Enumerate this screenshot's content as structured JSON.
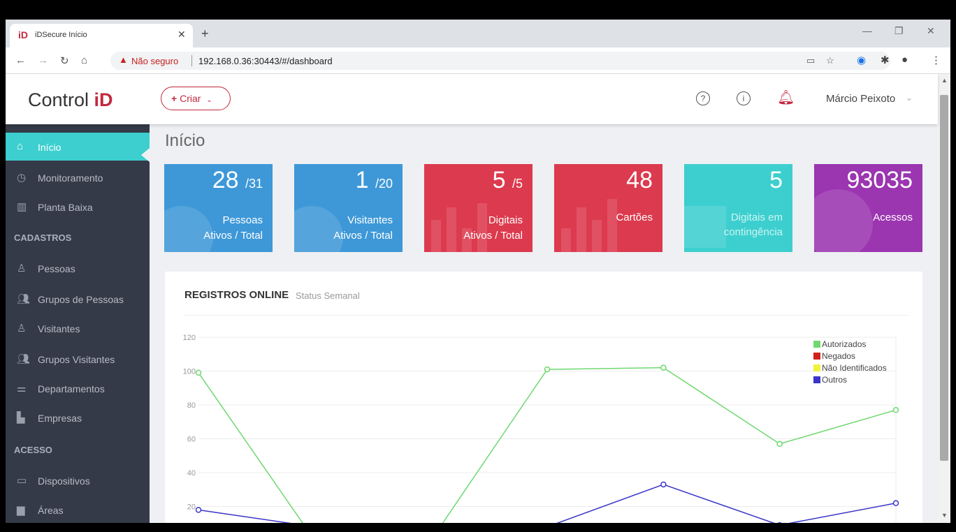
{
  "browser": {
    "tab_title": "iDSecure Início",
    "tab_favicon": "iD",
    "security_label": "Não seguro",
    "url": "192.168.0.36:30443/#/dashboard"
  },
  "header": {
    "logo_text": "Control ",
    "logo_brand": "iD",
    "create_label": "Criar",
    "user_name": "Márcio Peixoto",
    "accent_color": "#c4283e"
  },
  "sidebar": {
    "items_top": [
      {
        "label": "Início",
        "icon": "home-icon",
        "active": true
      },
      {
        "label": "Monitoramento",
        "icon": "gauge-icon"
      },
      {
        "label": "Planta Baixa",
        "icon": "floorplan-icon"
      }
    ],
    "section_cadastros": "CADASTROS",
    "items_cadastros": [
      {
        "label": "Pessoas",
        "icon": "user-icon"
      },
      {
        "label": "Grupos de Pessoas",
        "icon": "users-group-icon"
      },
      {
        "label": "Visitantes",
        "icon": "visitor-icon"
      },
      {
        "label": "Grupos Visitantes",
        "icon": "visitors-group-icon"
      },
      {
        "label": "Departamentos",
        "icon": "department-icon"
      },
      {
        "label": "Empresas",
        "icon": "company-icon"
      }
    ],
    "section_acesso": "ACESSO",
    "items_acesso": [
      {
        "label": "Dispositivos",
        "icon": "monitor-icon"
      },
      {
        "label": "Áreas",
        "icon": "area-icon"
      }
    ]
  },
  "main": {
    "title": "Início",
    "stats": [
      {
        "value": "28",
        "total": "/31",
        "label": "Pessoas",
        "sub": "Ativos / Total",
        "color": "#3e98d8"
      },
      {
        "value": "1",
        "total": "/20",
        "label": "Visitantes",
        "sub": "Ativos / Total",
        "color": "#3e98d8"
      },
      {
        "value": "5",
        "total": "/5",
        "label": "Digitais",
        "sub": "Ativos / Total",
        "color": "#dc3a4e"
      },
      {
        "value": "48",
        "total": "",
        "label": "Cartões",
        "sub": "",
        "color": "#dc3a4e"
      },
      {
        "value": "5",
        "total": "",
        "label": "Digitais em",
        "sub": "contingência",
        "color": "#3dcfcf"
      },
      {
        "value": "93035",
        "total": "",
        "label": "Acessos",
        "sub": "",
        "color": "#9b35b0"
      }
    ],
    "card_title": "REGISTROS ONLINE",
    "card_subtitle": "Status Semanal"
  },
  "chart_data": {
    "type": "line",
    "ylim": [
      0,
      120
    ],
    "yticks": [
      "120",
      "100",
      "80",
      "60",
      "40",
      "20"
    ],
    "legend_position": "top-right",
    "grid": true,
    "series": [
      {
        "name": "Autorizados",
        "color": "#6fd86f",
        "values": [
          99,
          0,
          0,
          101,
          102,
          57,
          77
        ]
      },
      {
        "name": "Negados",
        "color": "#d0211c",
        "values": []
      },
      {
        "name": "Não Identificados",
        "color": "#f2f23b",
        "values": []
      },
      {
        "name": "Outros",
        "color": "#3a35c8",
        "values": [
          18,
          8,
          0,
          8,
          33,
          9,
          22
        ]
      }
    ]
  }
}
